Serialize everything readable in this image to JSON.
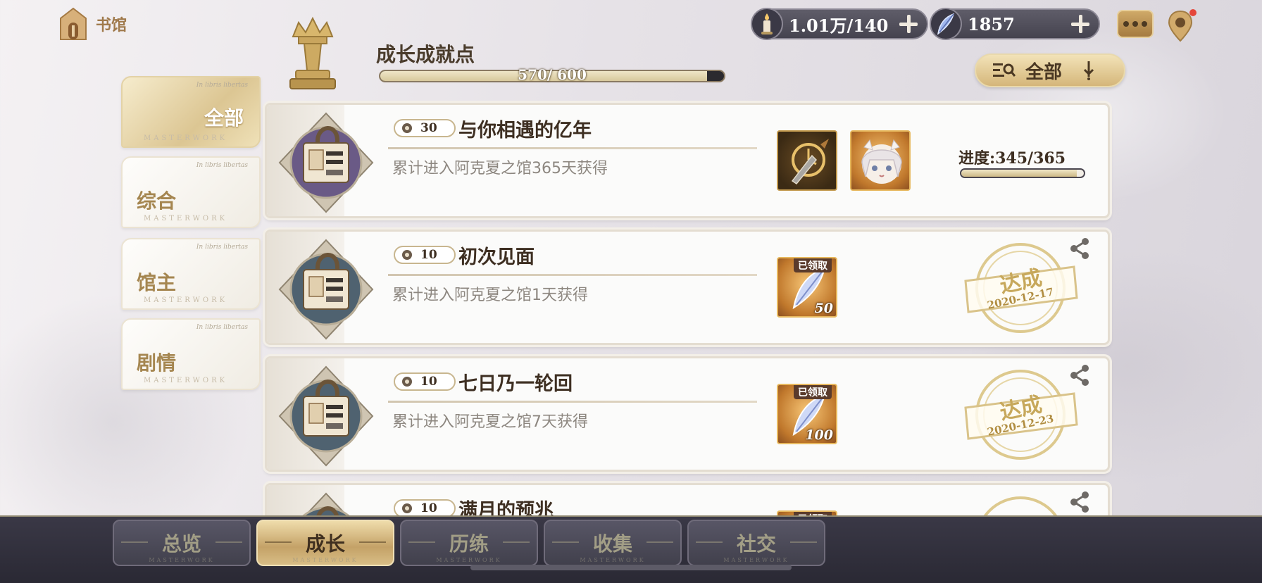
{
  "top_left": {
    "home_label": "书馆",
    "icon": "house-icon"
  },
  "header": {
    "title": "成长成就点",
    "progress_text": "570/ 600",
    "progress_current": 570,
    "progress_max": 600,
    "icon": "crown-chess-icon"
  },
  "resources": [
    {
      "icon": "candle-icon",
      "value": "1.01万/140"
    },
    {
      "icon": "quill-feather-icon",
      "value": "1857"
    }
  ],
  "filter": {
    "label": "全部",
    "icon": "filter-icon"
  },
  "categories": [
    {
      "label": "全部",
      "subtitle": "In libris libertas",
      "footer": "MASTERWORK",
      "active": true
    },
    {
      "label": "综合",
      "subtitle": "In libris libertas",
      "footer": "MASTERWORK",
      "active": false
    },
    {
      "label": "馆主",
      "subtitle": "In libris libertas",
      "footer": "MASTERWORK",
      "active": false
    },
    {
      "label": "剧情",
      "subtitle": "In libris libertas",
      "footer": "MASTERWORK",
      "active": false
    }
  ],
  "achievements": [
    {
      "points": "30",
      "title": "与你相遇的亿年",
      "desc": "累计进入阿克夏之馆365天获得",
      "emblem_color": "#6a5a86",
      "rewards": [
        {
          "icon": "clock-dagger-icon",
          "claimed": false,
          "count": ""
        },
        {
          "icon": "character-portrait-icon",
          "claimed": false,
          "count": ""
        }
      ],
      "progress_label": "进度:345/365",
      "progress_fraction": 0.945,
      "completed": false
    },
    {
      "points": "10",
      "title": "初次见面",
      "desc": "累计进入阿克夏之馆1天获得",
      "emblem_color": "#4f6270",
      "rewards": [
        {
          "icon": "quill-feather-icon",
          "claimed": true,
          "claimed_label": "已领取",
          "count": "50"
        }
      ],
      "completed": true,
      "stamp_text": "达成",
      "stamp_date": "2020-12-17"
    },
    {
      "points": "10",
      "title": "七日乃一轮回",
      "desc": "累计进入阿克夏之馆7天获得",
      "emblem_color": "#4f6270",
      "rewards": [
        {
          "icon": "quill-feather-icon",
          "claimed": true,
          "claimed_label": "已领取",
          "count": "100"
        }
      ],
      "completed": true,
      "stamp_text": "达成",
      "stamp_date": "2020-12-23"
    },
    {
      "points": "10",
      "title": "满月的预兆",
      "desc": "",
      "emblem_color": "#4f6270",
      "rewards": [
        {
          "icon": "quill-feather-icon",
          "claimed": true,
          "claimed_label": "已领取",
          "count": ""
        }
      ],
      "completed": true,
      "stamp_text": "",
      "stamp_date": ""
    }
  ],
  "bottom_nav": [
    {
      "label": "总览",
      "footer": "MASTERWORK",
      "active": false
    },
    {
      "label": "成长",
      "footer": "MASTERWORK",
      "active": true
    },
    {
      "label": "历练",
      "footer": "MASTERWORK",
      "active": false
    },
    {
      "label": "收集",
      "footer": "MASTERWORK",
      "active": false
    },
    {
      "label": "社交",
      "footer": "MASTERWORK",
      "active": false
    }
  ],
  "colors": {
    "gold": "#c7a85b",
    "dark_nav": "#2f2e3a",
    "text_brown": "#3e2f22"
  }
}
